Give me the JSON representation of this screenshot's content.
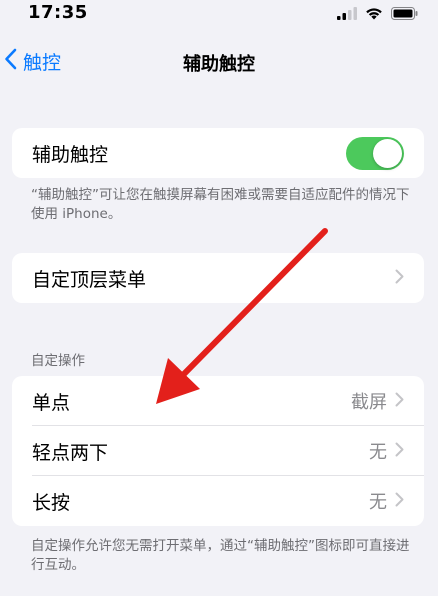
{
  "status_bar": {
    "time": "17:35",
    "icons": [
      "signal-icon",
      "wifi-icon",
      "battery-icon"
    ]
  },
  "nav": {
    "back_label": "触控",
    "title": "辅助触控"
  },
  "assistive_touch": {
    "label": "辅助触控",
    "toggle_on": true,
    "footer": "“辅助触控”可让您在触摸屏幕有困难或需要自适应配件的情况下使用 iPhone。"
  },
  "top_level_menu": {
    "label": "自定顶层菜单"
  },
  "custom_actions": {
    "header": "自定操作",
    "rows": [
      {
        "label": "单点",
        "value": "截屏"
      },
      {
        "label": "轻点两下",
        "value": "无"
      },
      {
        "label": "长按",
        "value": "无"
      }
    ],
    "footer": "自定操作允许您无需打开菜单，通过“辅助触控”图标即可直接进行互动。"
  },
  "colors": {
    "accent": "#0a7aff",
    "toggle_on": "#4cc95c",
    "annotation_arrow": "#e3201b"
  }
}
